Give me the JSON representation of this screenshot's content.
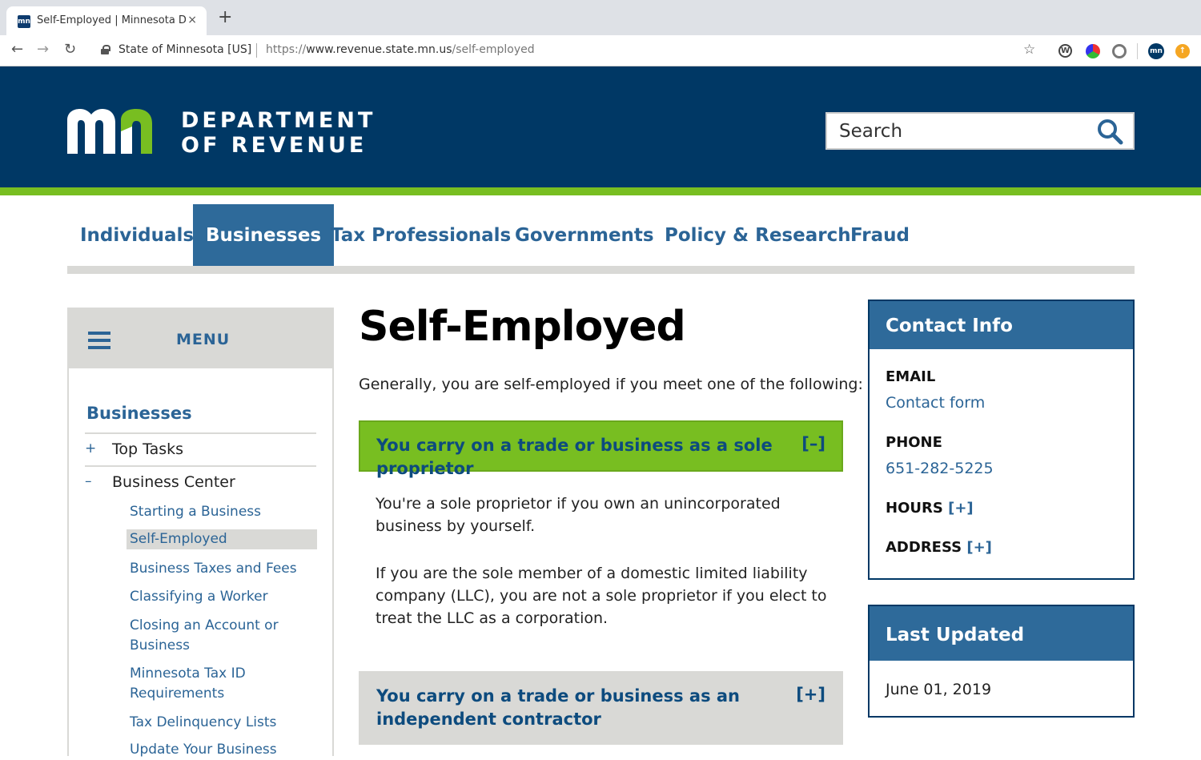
{
  "browser": {
    "tab_title": "Self-Employed | Minnesota De",
    "tab_favicon": "mn",
    "tab_close": "×",
    "new_tab": "+",
    "site_identity": "State of Minnesota [US]",
    "url_prefix": "https://",
    "url_host": "www.revenue.state.mn.us",
    "url_path": "/self-employed",
    "extension_badge": "mn"
  },
  "header": {
    "logo_line1": "DEPARTMENT",
    "logo_line2": "OF REVENUE",
    "search_placeholder": "Search"
  },
  "nav": {
    "items": [
      "Individuals",
      "Businesses",
      "Tax Professionals",
      "Governments",
      "Policy & Research",
      "Fraud"
    ],
    "active": "Businesses"
  },
  "sidebar": {
    "menu_label": "MENU",
    "section_title": "Businesses",
    "items": [
      {
        "sign": "+",
        "label": "Top Tasks"
      },
      {
        "sign": "–",
        "label": "Business Center"
      }
    ],
    "subitems": [
      "Starting a Business",
      "Self-Employed",
      "Business Taxes and Fees",
      "Classifying a Worker",
      "Closing an Account or Business",
      "Minnesota Tax ID Requirements",
      "Tax Delinquency Lists",
      "Update Your Business"
    ]
  },
  "main": {
    "title": "Self-Employed",
    "intro": "Generally, you are self-employed if you meet one of the following:",
    "accordion1_title": "You carry on a trade or business as a sole proprietor",
    "accordion1_toggle": "[–]",
    "accordion1_p1": "You're a sole proprietor if you own an unincorporated business by yourself.",
    "accordion1_p2": "If you are the sole member of a domestic limited liability company (LLC), you are not a sole proprietor if you elect to treat the LLC as a corporation.",
    "accordion2_title": "You carry on a trade or business as an independent contractor",
    "accordion2_toggle": "[+]"
  },
  "contact": {
    "heading": "Contact Info",
    "email_label": "EMAIL",
    "email_link": "Contact form",
    "phone_label": "PHONE",
    "phone": "651-282-5225",
    "hours_label": "HOURS",
    "address_label": "ADDRESS",
    "expand": "[+]"
  },
  "updated": {
    "heading": "Last Updated",
    "date": "June 01, 2019"
  },
  "colors": {
    "header_bg": "#003865",
    "accent_green": "#78be21",
    "link_blue": "#2b6496",
    "panel_gray": "#d9d9d6"
  }
}
